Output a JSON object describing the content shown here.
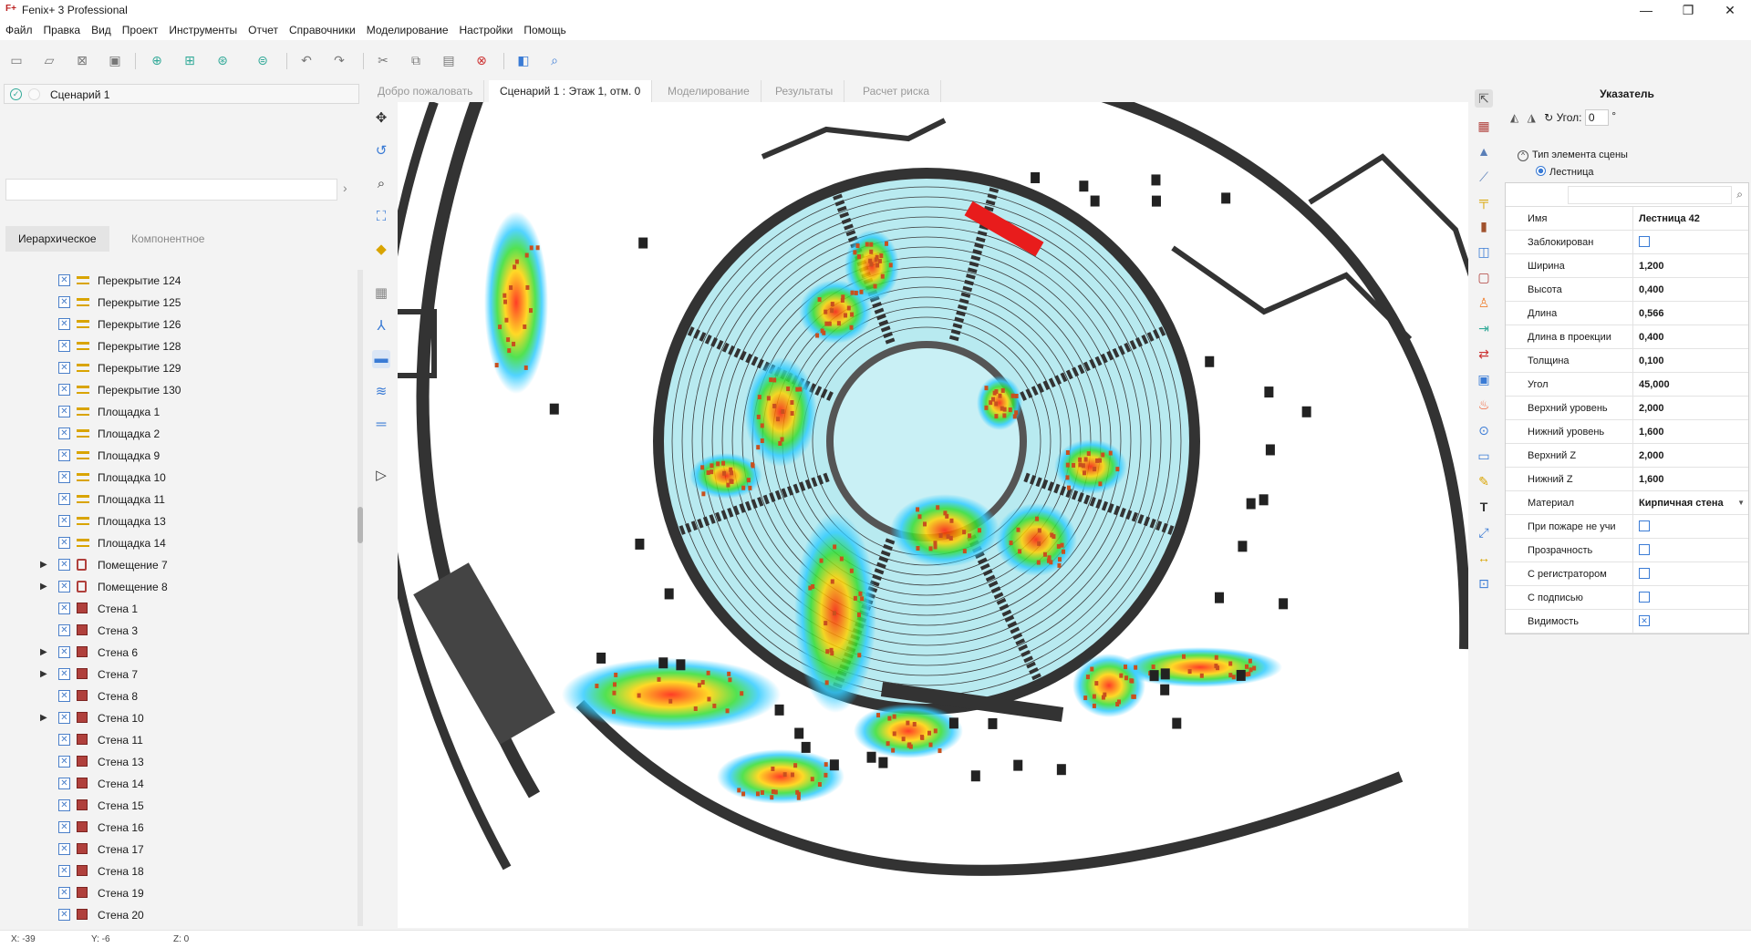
{
  "window": {
    "title": "Fenix+ 3 Professional",
    "logo": "F+",
    "controls": [
      "—",
      "❐",
      "✕"
    ]
  },
  "menu": [
    "Файл",
    "Правка",
    "Вид",
    "Проект",
    "Инструменты",
    "Отчет",
    "Справочники",
    "Моделирование",
    "Настройки",
    "Помощь"
  ],
  "scenario_panel": {
    "item": "Сценарий 1",
    "search_value": ""
  },
  "view_tabs": [
    "Иерархическое",
    "Компонентное"
  ],
  "tree": [
    {
      "label": "Перекрытие 124",
      "type": "floor",
      "expandable": false
    },
    {
      "label": "Перекрытие 125",
      "type": "floor",
      "expandable": false
    },
    {
      "label": "Перекрытие 126",
      "type": "floor",
      "expandable": false
    },
    {
      "label": "Перекрытие 128",
      "type": "floor",
      "expandable": false
    },
    {
      "label": "Перекрытие 129",
      "type": "floor",
      "expandable": false
    },
    {
      "label": "Перекрытие 130",
      "type": "floor",
      "expandable": false
    },
    {
      "label": "Площадка 1",
      "type": "floor",
      "expandable": false
    },
    {
      "label": "Площадка 2",
      "type": "floor",
      "expandable": false
    },
    {
      "label": "Площадка 9",
      "type": "floor",
      "expandable": false
    },
    {
      "label": "Площадка 10",
      "type": "floor",
      "expandable": false
    },
    {
      "label": "Площадка 11",
      "type": "floor",
      "expandable": false
    },
    {
      "label": "Площадка 13",
      "type": "floor",
      "expandable": false
    },
    {
      "label": "Площадка 14",
      "type": "floor",
      "expandable": false
    },
    {
      "label": "Помещение 7",
      "type": "room",
      "expandable": true
    },
    {
      "label": "Помещение 8",
      "type": "room",
      "expandable": true
    },
    {
      "label": "Стена 1",
      "type": "wall",
      "expandable": false
    },
    {
      "label": "Стена 3",
      "type": "wall",
      "expandable": false
    },
    {
      "label": "Стена 6",
      "type": "wall",
      "expandable": true
    },
    {
      "label": "Стена 7",
      "type": "wall",
      "expandable": true
    },
    {
      "label": "Стена 8",
      "type": "wall",
      "expandable": false
    },
    {
      "label": "Стена 10",
      "type": "wall",
      "expandable": true
    },
    {
      "label": "Стена 11",
      "type": "wall",
      "expandable": false
    },
    {
      "label": "Стена 13",
      "type": "wall",
      "expandable": false
    },
    {
      "label": "Стена 14",
      "type": "wall",
      "expandable": false
    },
    {
      "label": "Стена 15",
      "type": "wall",
      "expandable": false
    },
    {
      "label": "Стена 16",
      "type": "wall",
      "expandable": false
    },
    {
      "label": "Стена 17",
      "type": "wall",
      "expandable": false
    },
    {
      "label": "Стена 18",
      "type": "wall",
      "expandable": false
    },
    {
      "label": "Стена 19",
      "type": "wall",
      "expandable": false
    },
    {
      "label": "Стена 20",
      "type": "wall",
      "expandable": false
    }
  ],
  "doc_tabs": [
    {
      "label": "Добро пожаловать",
      "active": false
    },
    {
      "label": "Сценарий 1 : Этаж 1, отм. 0",
      "active": true
    },
    {
      "label": "Моделирование",
      "active": false
    },
    {
      "label": "Результаты",
      "active": false
    },
    {
      "label": "Расчет риска",
      "active": false
    }
  ],
  "properties": {
    "header": "Указатель",
    "angle_label": "Угол:",
    "angle_value": "0",
    "angle_unit": "°",
    "element_type_label": "Тип элемента сцены",
    "element_type_value": "Лестница",
    "rows": [
      {
        "key": "Имя",
        "value": "Лестница 42",
        "kind": "text"
      },
      {
        "key": "Заблокирован",
        "value": "",
        "kind": "check",
        "checked": false
      },
      {
        "key": "Ширина",
        "value": "1,200",
        "kind": "text"
      },
      {
        "key": "Высота",
        "value": "0,400",
        "kind": "text"
      },
      {
        "key": "Длина",
        "value": "0,566",
        "kind": "text"
      },
      {
        "key": "Длина в проекции",
        "value": "0,400",
        "kind": "text"
      },
      {
        "key": "Толщина",
        "value": "0,100",
        "kind": "text"
      },
      {
        "key": "Угол",
        "value": "45,000",
        "kind": "text"
      },
      {
        "key": "Верхний уровень",
        "value": "2,000",
        "kind": "text"
      },
      {
        "key": "Нижний уровень",
        "value": "1,600",
        "kind": "text"
      },
      {
        "key": "Верхний Z",
        "value": "2,000",
        "kind": "text"
      },
      {
        "key": "Нижний Z",
        "value": "1,600",
        "kind": "text"
      },
      {
        "key": "Материал",
        "value": "Кирпичная стена",
        "kind": "select"
      },
      {
        "key": "При пожаре не учи",
        "value": "",
        "kind": "check",
        "checked": false
      },
      {
        "key": "Прозрачность",
        "value": "",
        "kind": "check",
        "checked": false
      },
      {
        "key": "С регистратором",
        "value": "",
        "kind": "check",
        "checked": false
      },
      {
        "key": "С подписью",
        "value": "",
        "kind": "check",
        "checked": false
      },
      {
        "key": "Видимость",
        "value": "",
        "kind": "check",
        "checked": true
      }
    ]
  },
  "status": {
    "x": "X: -39",
    "y": "Y: -6",
    "z": "Z: 0"
  },
  "colors": {
    "accent": "#3a7bd5",
    "wall": "#333333",
    "seat_fill": "#b8eaf0",
    "heat_high": "#ff1a00",
    "person": "#c8501e"
  }
}
